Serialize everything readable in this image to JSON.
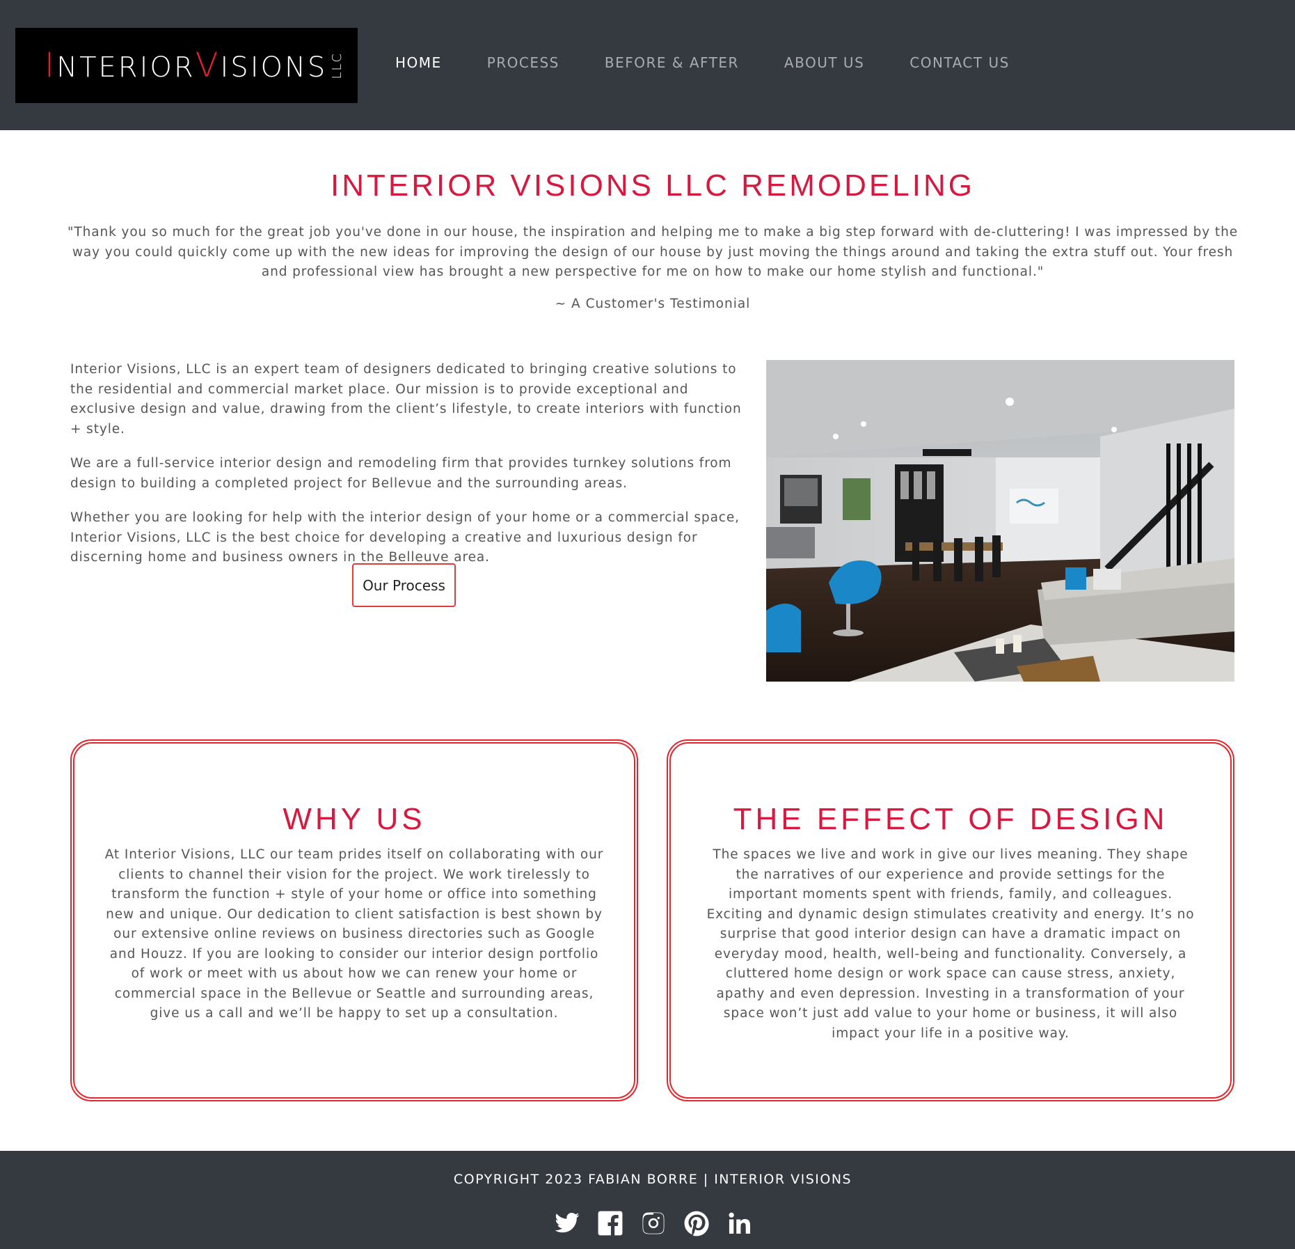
{
  "header": {
    "logo": {
      "letter_i": "I",
      "part_1": "NTERIOR ",
      "letter_v": "V",
      "part_2": "ISIONS",
      "suffix": "LLC"
    },
    "nav": [
      {
        "label": "HOME",
        "active": true
      },
      {
        "label": "PROCESS",
        "active": false
      },
      {
        "label": "BEFORE & AFTER",
        "active": false
      },
      {
        "label": "ABOUT US",
        "active": false
      },
      {
        "label": "CONTACT US",
        "active": false
      }
    ]
  },
  "main": {
    "title": "INTERIOR VISIONS LLC REMODELING",
    "testimonial": "\"Thank you so much for the great job you've done in our house, the inspiration and helping me to make a big step forward with de-cluttering! I was impressed by the way you could quickly come up with the new ideas for improving the design of our house by just moving the things around and taking the extra stuff out. Your fresh and professional view has brought a new perspective for me on how to make our home stylish and functional.\"",
    "testimonial_attribution": "~ A Customer's Testimonial",
    "intro_paragraphs": [
      "Interior Visions, LLC is an expert team of designers dedicated to bringing creative solutions to the residential and commercial market place. Our mission is to provide exceptional and exclusive design and value, drawing from the client’s lifestyle, to create interiors with function + style.",
      "We are a full-service interior design and remodeling firm that provides turnkey solutions from design to building a completed project for Bellevue and the surrounding areas.",
      "Whether you are looking for help with the interior design of your home or a commercial space, Interior Visions, LLC is the best choice for developing a creative and luxurious design for discerning home and business owners in the Belleuve area."
    ],
    "process_button": "Our Process"
  },
  "cards": [
    {
      "title": "WHY US",
      "body": "At Interior Visions, LLC our team prides itself on collaborating with our clients to channel their vision for the project. We work tirelessly to transform the function + style of your home or office into something new and unique. Our dedication to client satisfaction is best shown by our extensive online reviews on business directories such as Google and Houzz. If you are looking to consider our interior design portfolio of work or meet with us about how we can renew your home or commercial space in the Bellevue or Seattle and surrounding areas, give us a call and we’ll be happy to set up a consultation."
    },
    {
      "title": "THE EFFECT OF DESIGN",
      "body": "The spaces we live and work in give our lives meaning. They shape the narratives of our experience and provide settings for the important moments spent with friends, family, and colleagues. Exciting and dynamic design stimulates creativity and energy. It’s no surprise that good interior design can have a dramatic impact on everyday mood, health, well-being and functionality. Conversely, a cluttered home design or work space can cause stress, anxiety, apathy and even depression. Investing in a transformation of your space won’t just add value to your home or business, it will also impact your life in a positive way."
    }
  ],
  "footer": {
    "copyright": "COPYRIGHT 2023 FABIAN BORRE | INTERIOR VISIONS",
    "social_icons": [
      "twitter-icon",
      "facebook-icon",
      "instagram-icon",
      "pinterest-icon",
      "linkedin-icon"
    ]
  },
  "colors": {
    "header_bg": "#353940",
    "accent_red": "#d7183f",
    "card_border": "#e5242c",
    "body_text": "#555555",
    "nav_active": "#ffffff",
    "nav_inactive": "#a9acb0"
  }
}
